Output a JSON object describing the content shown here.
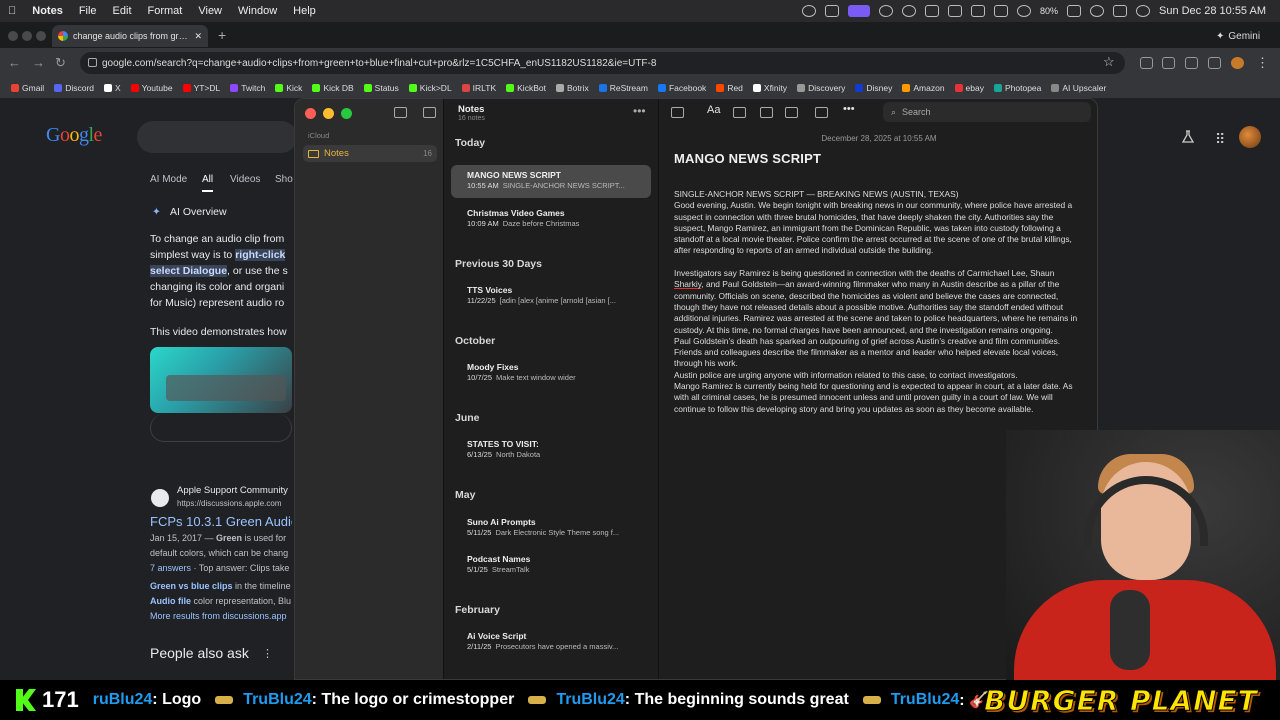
{
  "menubar": {
    "app": "Notes",
    "items": [
      "File",
      "Edit",
      "Format",
      "View",
      "Window",
      "Help"
    ],
    "battery": "80%",
    "datetime": "Sun Dec 28  10:55 AM"
  },
  "browser": {
    "tab_title": "change audio clips from green",
    "gemini_label": "Gemini",
    "url": "google.com/search?q=change+audio+clips+from+green+to+blue+final+cut+pro&rlz=1C5CHFA_enUS1182US1182&ie=UTF-8",
    "bookmarks": [
      {
        "label": "Gmail",
        "color": "#ea4335"
      },
      {
        "label": "Discord",
        "color": "#5865f2"
      },
      {
        "label": "X",
        "color": "#ffffff"
      },
      {
        "label": "Youtube",
        "color": "#ff0000"
      },
      {
        "label": "YT>DL",
        "color": "#ff0000"
      },
      {
        "label": "Twitch",
        "color": "#9146ff"
      },
      {
        "label": "Kick",
        "color": "#53fc18"
      },
      {
        "label": "Kick DB",
        "color": "#53fc18"
      },
      {
        "label": "Status",
        "color": "#53fc18"
      },
      {
        "label": "Kick>DL",
        "color": "#53fc18"
      },
      {
        "label": "IRLTK",
        "color": "#d44"
      },
      {
        "label": "KickBot",
        "color": "#53fc18"
      },
      {
        "label": "Botrix",
        "color": "#aaaaaa"
      },
      {
        "label": "ReStream",
        "color": "#1a73e8"
      },
      {
        "label": "Facebook",
        "color": "#1877f2"
      },
      {
        "label": "Red",
        "color": "#ff4500"
      },
      {
        "label": "Xfinity",
        "color": "#ffffff"
      },
      {
        "label": "Discovery",
        "color": "#999999"
      },
      {
        "label": "Disney",
        "color": "#113ccf"
      },
      {
        "label": "Amazon",
        "color": "#ff9900"
      },
      {
        "label": "ebay",
        "color": "#e53238"
      },
      {
        "label": "Photopea",
        "color": "#18a497"
      },
      {
        "label": "AI Upscaler",
        "color": "#888888"
      }
    ]
  },
  "google": {
    "logo": "Google",
    "tabs": [
      "AI Mode",
      "All",
      "Videos",
      "Sho"
    ],
    "ai_overview": "AI Overview",
    "ai_line1": "To change an audio clip from",
    "ai_line2a": "simplest way is to ",
    "ai_line2b": "right-click",
    "ai_line3a": "select Dialogue",
    "ai_line3b": ", or use the s",
    "ai_line4": "changing its color and organi",
    "ai_line5": "for Music) represent audio ro",
    "video_line": "This video demonstrates how",
    "result_site": "Apple Support Community",
    "result_url": "https://discussions.apple.com",
    "result_title": "FCPs 10.3.1 Green Audic",
    "result_date": "Jan 15, 2017 — ",
    "result_green": "Green",
    "result_snip1": " is used for",
    "result_snip2": "default colors, which can be chang",
    "result_answers": "7 answers",
    "result_top": " · Top answer: Clips take",
    "related1a": "Green vs blue clips",
    "related1b": " in the timeline",
    "related2a": "Audio file",
    "related2b": " color representation, Blu",
    "more_results": "More results from discussions.app",
    "paa": "People also ask"
  },
  "notes_app": {
    "sidebar": {
      "account": "iCloud",
      "folder": "Notes",
      "folder_count": "16"
    },
    "list": {
      "title": "Notes",
      "count": "16 notes",
      "sections": [
        {
          "label": "Today",
          "notes": [
            {
              "title": "MANGO NEWS SCRIPT",
              "time": "10:55 AM",
              "preview": "SINGLE-ANCHOR NEWS SCRIPT..."
            },
            {
              "title": "Christmas Video Games",
              "time": "10:09 AM",
              "preview": "Daze before Christmas"
            }
          ]
        },
        {
          "label": "Previous 30 Days",
          "notes": [
            {
              "title": "TTS Voices",
              "time": "11/22/25",
              "preview": "[adin [alex [anime [arnold [asian [..."
            }
          ]
        },
        {
          "label": "October",
          "notes": [
            {
              "title": "Moody Fixes",
              "time": "10/7/25",
              "preview": "Make text window wider"
            }
          ]
        },
        {
          "label": "June",
          "notes": [
            {
              "title": "STATES TO VISIT:",
              "time": "6/13/25",
              "preview": "North Dakota"
            }
          ]
        },
        {
          "label": "May",
          "notes": [
            {
              "title": "Suno Ai Prompts",
              "time": "5/11/25",
              "preview": "Dark Electronic Style Theme song f..."
            },
            {
              "title": "Podcast Names",
              "time": "5/1/25",
              "preview": "StreamTalk"
            }
          ]
        },
        {
          "label": "February",
          "notes": [
            {
              "title": "Ai Voice Script",
              "time": "2/11/25",
              "preview": "Prosecutors have opened a massiv..."
            }
          ]
        }
      ]
    },
    "editor": {
      "search_placeholder": "Search",
      "date": "December 28, 2025 at 10:55 AM",
      "title": "MANGO NEWS SCRIPT",
      "p1": "SINGLE-ANCHOR NEWS SCRIPT — BREAKING NEWS (AUSTIN, TEXAS)",
      "p2": "Good evening, Austin. We begin tonight with breaking news in our community, where police have arrested a suspect in connection with three brutal homicides, that have deeply shaken the city. Authorities say the suspect, Mango Ramirez, an immigrant from the Dominican Republic, was taken into custody following a standoff at a local movie theater. Police confirm the arrest occurred at the scene of one of the brutal killings, after responding to reports of an armed individual outside the building.",
      "p3a": "Investigators say Ramirez is being questioned in connection with the deaths of Carmichael Lee, Shaun ",
      "p3b": "Sharkiy",
      "p3c": ", and Paul Goldstein—an award-winning filmmaker who many in Austin describe as a pillar of the community. Officials on scene, described the homicides as violent and believe the cases are connected, though they have not released details about a possible motive. Authorities say the standoff ended without additional injuries. Ramirez was arrested at the scene and taken to police headquarters, where he remains in custody. At this time, no formal charges have been announced, and the investigation remains ongoing.",
      "p4": "Paul Goldstein’s death has sparked an outpouring of grief across Austin’s creative and film communities. Friends and colleagues describe the filmmaker as a mentor and leader who helped elevate local voices, through his work.",
      "p5": "Austin police are urging anyone with information related to this case, to contact investigators.",
      "p6": "Mango Ramirez is currently being held for questioning and is expected to appear in court, at a later date. As with all criminal cases, he is presumed innocent unless and until proven guilty in a court of law. We will continue to follow this developing story and bring you updates as soon as they become available."
    }
  },
  "stream": {
    "viewers": "171",
    "messages": [
      {
        "user": "ruBlu24",
        "text": ": Logo"
      },
      {
        "user": "TruBlu24",
        "text": ": The logo or crimestopper"
      },
      {
        "user": "TruBlu24",
        "text": ": The beginning sounds great"
      },
      {
        "user": "TruBlu24",
        "text": ": 🎸"
      }
    ],
    "sponsor": "BURGER PLANET"
  }
}
